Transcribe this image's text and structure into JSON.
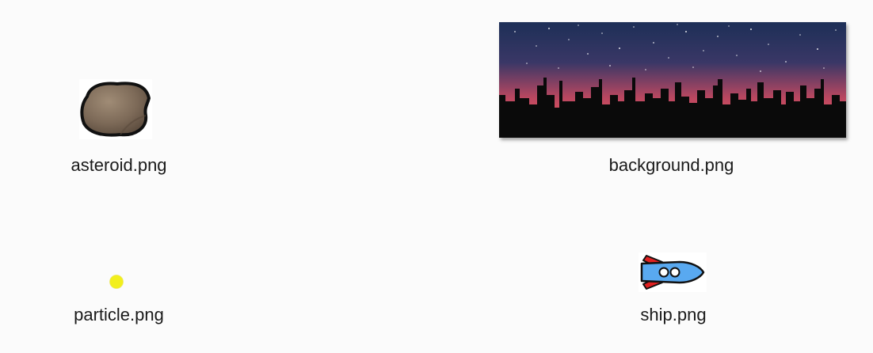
{
  "files": {
    "asteroid": {
      "name": "asteroid.png",
      "icon": "asteroid-thumbnail"
    },
    "background": {
      "name": "background.png",
      "icon": "city-skyline-thumbnail"
    },
    "particle": {
      "name": "particle.png",
      "icon": "yellow-dot-thumbnail"
    },
    "ship": {
      "name": "ship.png",
      "icon": "rocket-ship-thumbnail"
    }
  },
  "colors": {
    "pane_background": "#fbfbfb",
    "label_text": "#1a1a1a",
    "sky_top": "#1d2f57",
    "sky_bottom": "#e5525e",
    "skyline": "#0a0a0a",
    "particle": "#f2ef1c",
    "ship_body": "#59a9f0",
    "ship_fins": "#e02121",
    "asteroid": "#7d6a58"
  }
}
